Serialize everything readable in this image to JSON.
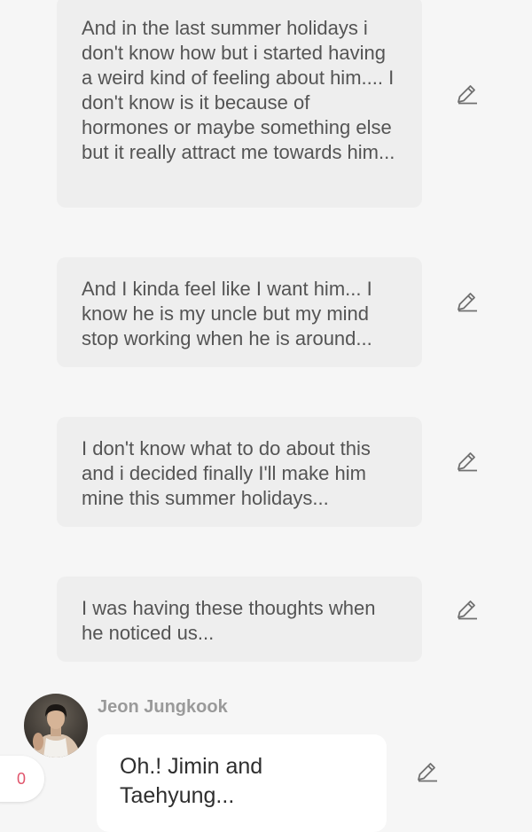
{
  "narrations": [
    {
      "text": "And in the last summer holidays i don't know how but i started having a weird kind of feeling about him.... I don't know is it because of hormones or maybe something else but it really attract me towards him..."
    },
    {
      "text": "And I kinda feel like I want him... I know he is my uncle but my mind stop working when he is around..."
    },
    {
      "text": "I don't know what to do about this and i decided finally I'll make him mine this summer holidays..."
    },
    {
      "text": "I was having these thoughts when he noticed us..."
    }
  ],
  "dialogue": {
    "speaker_name": "Jeon Jungkook",
    "text": "Oh.! Jimin and Taehyung..."
  },
  "reaction": {
    "count": "0",
    "color": "#e0546b"
  },
  "icons": {
    "edit": "pencil-icon",
    "avatar": "avatar-photo"
  }
}
